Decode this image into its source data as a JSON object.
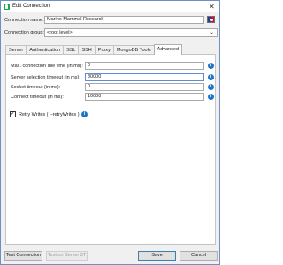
{
  "window": {
    "title": "Edit Connection",
    "close_glyph": "✕"
  },
  "connection_name": {
    "label": "Connection name:",
    "value": "Marine Mammal Research"
  },
  "connection_group": {
    "label": "Connection group:",
    "value": "<root level>"
  },
  "tabs": [
    {
      "label": "Server",
      "active": false
    },
    {
      "label": "Authentication",
      "active": false
    },
    {
      "label": "SSL",
      "active": false
    },
    {
      "label": "SSH",
      "active": false
    },
    {
      "label": "Proxy",
      "active": false
    },
    {
      "label": "MongoDB Tools",
      "active": false
    },
    {
      "label": "Advanced",
      "active": true
    }
  ],
  "advanced": {
    "fields": [
      {
        "label": "Max. connection idle time (in ms):",
        "value": "0"
      },
      {
        "label": "Server selection timeout (in ms):",
        "value": "30000"
      },
      {
        "label": "Socket timeout (in ms):",
        "value": "0"
      },
      {
        "label": "Connect timeout (in ms):",
        "value": "10000"
      }
    ],
    "retry_writes": {
      "label": "Retry Writes ( --retryWrites )",
      "checked": true
    }
  },
  "info_glyph": "i",
  "buttons": {
    "test_connection": "Test Connection",
    "test_on_server": "Test on Server 3T",
    "save": "Save",
    "cancel": "Cancel"
  },
  "colors": {
    "info": "#1e74c6",
    "app_icon": "#13aa52",
    "window_border": "#6d8fc4"
  }
}
